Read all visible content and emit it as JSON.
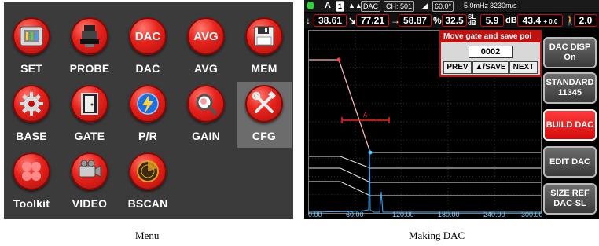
{
  "menu": {
    "items": [
      {
        "label": "SET",
        "icon": "settings-panel-icon"
      },
      {
        "label": "PROBE",
        "icon": "probe-icon"
      },
      {
        "label": "DAC",
        "icon": "dac-text-icon",
        "icon_text": "DAC"
      },
      {
        "label": "AVG",
        "icon": "avg-text-icon",
        "icon_text": "AVG"
      },
      {
        "label": "MEM",
        "icon": "floppy-disk-icon"
      },
      {
        "label": "BASE",
        "icon": "gear-icon"
      },
      {
        "label": "GATE",
        "icon": "door-icon"
      },
      {
        "label": "P/R",
        "icon": "lightning-icon"
      },
      {
        "label": "GAIN",
        "icon": "magnifier-icon"
      },
      {
        "label": "CFG",
        "icon": "tools-icon"
      },
      {
        "label": "Toolkit",
        "icon": "dots-icon"
      },
      {
        "label": "VIDEO",
        "icon": "video-camera-icon"
      },
      {
        "label": "BSCAN",
        "icon": "radar-icon"
      }
    ],
    "selected": "CFG"
  },
  "status": {
    "channel_letter": "A",
    "channel_num": "1",
    "mode": "DAC",
    "ch": "CH: 501",
    "angle": "60.0°",
    "freq": "5.0mHz",
    "velocity": "3230m/s"
  },
  "readings": {
    "r1": "38.61",
    "r2": "77.21",
    "r3": "58.87",
    "pct": "32.5",
    "sl": "5.9",
    "db": "43.4",
    "db_offset": "+ 0.0",
    "step": "2.0",
    "pct_sym": "%",
    "db_sym": "dB"
  },
  "popup": {
    "title": "Move gate and save poi",
    "value": "0002",
    "prev": "PREV",
    "save": "▲/SAVE",
    "next": "NEXT"
  },
  "buttons": [
    {
      "line1": "DAC DISP",
      "line2": "On",
      "active": false
    },
    {
      "line1": "STANDARD",
      "line2": "11345",
      "active": false
    },
    {
      "line1": "BUILD DAC",
      "line2": "",
      "active": true
    },
    {
      "line1": "EDIT DAC",
      "line2": "",
      "active": false
    },
    {
      "line1": "SIZE REF",
      "line2": "DAC-SL",
      "active": false
    }
  ],
  "gate_label": "A",
  "x_ticks": [
    "0.00",
    "60.00",
    "120.00",
    "180.00",
    "240.00",
    "300.00"
  ],
  "captions": {
    "left": "Menu",
    "right": "Making DAC"
  },
  "colors": {
    "accent": "#e8231d",
    "plot_bg": "#000000",
    "dac_curve": "#ffb0b0",
    "axis_text": "#7fd0ff"
  }
}
